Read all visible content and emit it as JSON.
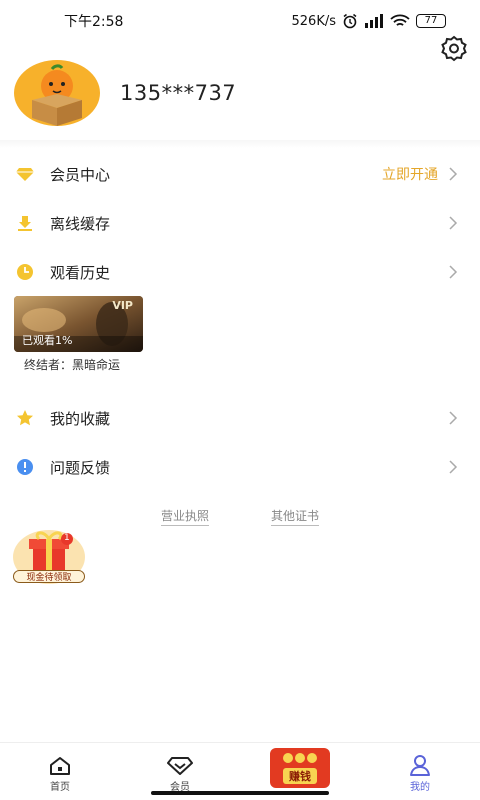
{
  "status": {
    "time": "下午2:58",
    "speed": "526K/s",
    "battery": "77"
  },
  "profile": {
    "phone": "135***737"
  },
  "menu": {
    "vip_center": {
      "label": "会员中心",
      "extra": "立即开通"
    },
    "offline_cache": {
      "label": "离线缓存"
    },
    "history": {
      "label": "观看历史"
    },
    "favorites": {
      "label": "我的收藏"
    },
    "feedback": {
      "label": "问题反馈"
    }
  },
  "history_item": {
    "badge": "VIP",
    "progress": "已观看1%",
    "title": "终结者：黑暗命运"
  },
  "links": {
    "license": "营业执照",
    "certs": "其他证书"
  },
  "gift": {
    "label": "现金待领取",
    "count": "1"
  },
  "tabs": {
    "home": "首页",
    "vip": "会员",
    "earn": "赚钱",
    "mine": "我的"
  },
  "colors": {
    "accent": "#e4a62a",
    "active_tab": "#5a63d8",
    "earn_red": "#e23a21"
  }
}
